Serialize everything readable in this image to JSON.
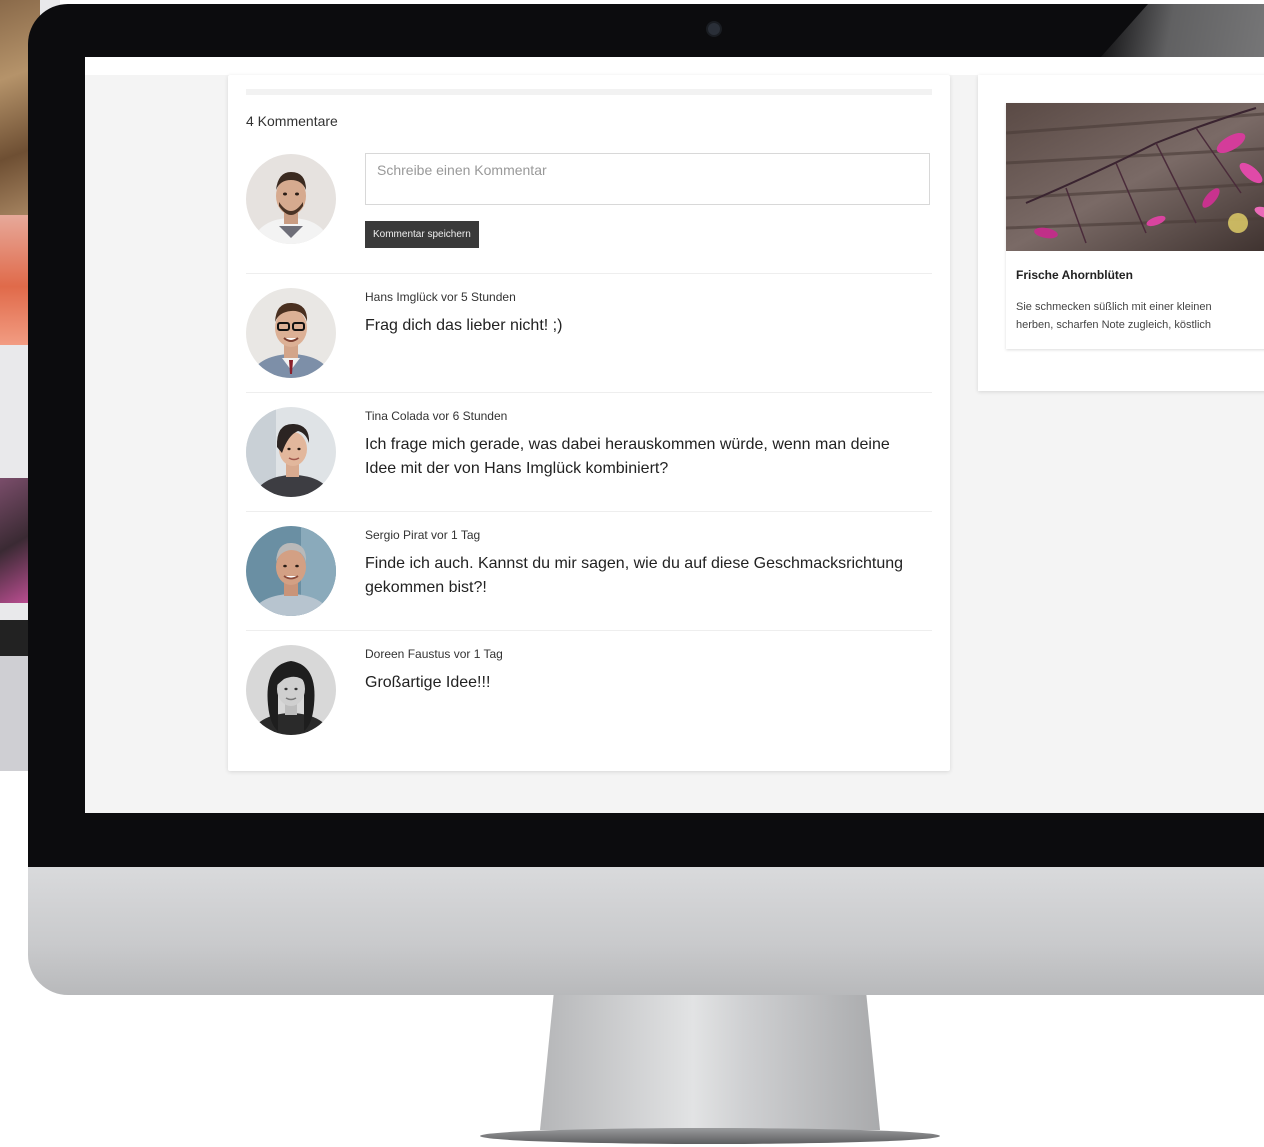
{
  "comments_section": {
    "count_label": "4 Kommentare",
    "input_placeholder": "Schreibe einen Kommentar",
    "save_label": "Kommentar speichern",
    "comments": [
      {
        "author": "Hans Imglück",
        "time": "vor 5 Stunden",
        "meta": "Hans Imglück vor 5 Stunden",
        "text": "Frag dich das lieber nicht! ;)"
      },
      {
        "author": "Tina Colada",
        "time": "vor 6 Stunden",
        "meta": "Tina Colada vor 6 Stunden",
        "text": "Ich frage mich gerade, was dabei herauskommen würde, wenn man deine Idee mit der von Hans Imglück kombiniert?"
      },
      {
        "author": "Sergio Pirat",
        "time": "vor 1 Tag",
        "meta": "Sergio Pirat vor 1 Tag",
        "text": "Finde ich auch. Kannst du mir sagen, wie du auf diese Geschmacksrichtung gekommen bist?!"
      },
      {
        "author": "Doreen Faustus",
        "time": "vor 1 Tag",
        "meta": "Doreen Faustus vor 1 Tag",
        "text": "Großartige Idee!!!"
      }
    ]
  },
  "sidebar": {
    "card_title": "Frische Ahornblüten",
    "card_description": "Sie schmecken süßlich mit einer kleinen\nherben, scharfen Note zugleich, köstlich"
  },
  "colors": {
    "screen_background": "#f4f4f4",
    "card_background": "#ffffff",
    "button_background": "#3a3a3a",
    "bezel": "#0c0c0e"
  },
  "icons": {
    "current_user_avatar": "avatar-photo",
    "commenter_avatars": "avatar-photo"
  }
}
